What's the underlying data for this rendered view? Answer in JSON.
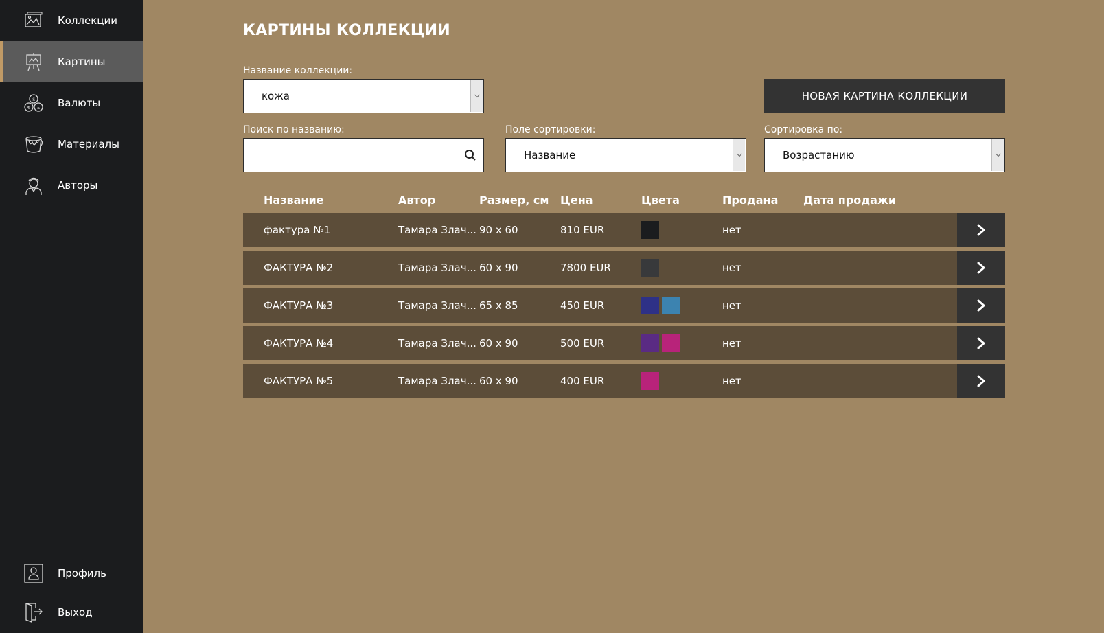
{
  "sidebar": {
    "items": [
      {
        "label": "Коллекции",
        "icon": "collections-icon"
      },
      {
        "label": "Картины",
        "icon": "easel-icon",
        "active": true
      },
      {
        "label": "Валюты",
        "icon": "coins-icon"
      },
      {
        "label": "Материалы",
        "icon": "paint-bucket-icon"
      },
      {
        "label": "Авторы",
        "icon": "artist-icon"
      }
    ],
    "bottom": [
      {
        "label": "Профиль",
        "icon": "profile-icon"
      },
      {
        "label": "Выход",
        "icon": "logout-icon"
      }
    ]
  },
  "main": {
    "title": "КАРТИНЫ КОЛЛЕКЦИИ",
    "collection_label": "Название коллекции:",
    "collection_value": "кожа",
    "new_button_label": "НОВАЯ КАРТИНА КОЛЛЕКЦИИ",
    "search_label": "Поиск по названию:",
    "search_value": "",
    "sort_field_label": "Поле сортировки:",
    "sort_field_value": "Название",
    "sort_order_label": "Сортировка по:",
    "sort_order_value": "Возрастанию"
  },
  "table": {
    "headers": [
      "Название",
      "Автор",
      "Размер, см",
      "Цена",
      "Цвета",
      "Продана",
      "Дата продажи"
    ],
    "rows": [
      {
        "name": "фактура №1",
        "author": "Тамара Злач...",
        "size": "90 x 60",
        "price": "810 EUR",
        "colors": [
          "#1b1c1e"
        ],
        "sold": "нет",
        "sale_date": ""
      },
      {
        "name": "ФАКТУРА №2",
        "author": "Тамара Злач...",
        "size": "60 x 90",
        "price": "7800 EUR",
        "colors": [
          "#38393b"
        ],
        "sold": "нет",
        "sale_date": ""
      },
      {
        "name": "ФАКТУРА №3",
        "author": "Тамара Злач...",
        "size": "65 x 85",
        "price": "450 EUR",
        "colors": [
          "#2e3187",
          "#3c83b0"
        ],
        "sold": "нет",
        "sale_date": ""
      },
      {
        "name": "ФАКТУРА №4",
        "author": "Тамара Злач...",
        "size": "60 x 90",
        "price": "500 EUR",
        "colors": [
          "#5a2b83",
          "#b8237a"
        ],
        "sold": "нет",
        "sale_date": ""
      },
      {
        "name": "ФАКТУРА №5",
        "author": "Тамара Злач...",
        "size": "60 x 90",
        "price": "400 EUR",
        "colors": [
          "#b8237a"
        ],
        "sold": "нет",
        "sale_date": ""
      }
    ]
  },
  "colors": {
    "background": "#a08763",
    "sidebar": "#1b1c1e",
    "row": "#5c4d39",
    "button": "#333333",
    "accent": "#c09a66"
  }
}
